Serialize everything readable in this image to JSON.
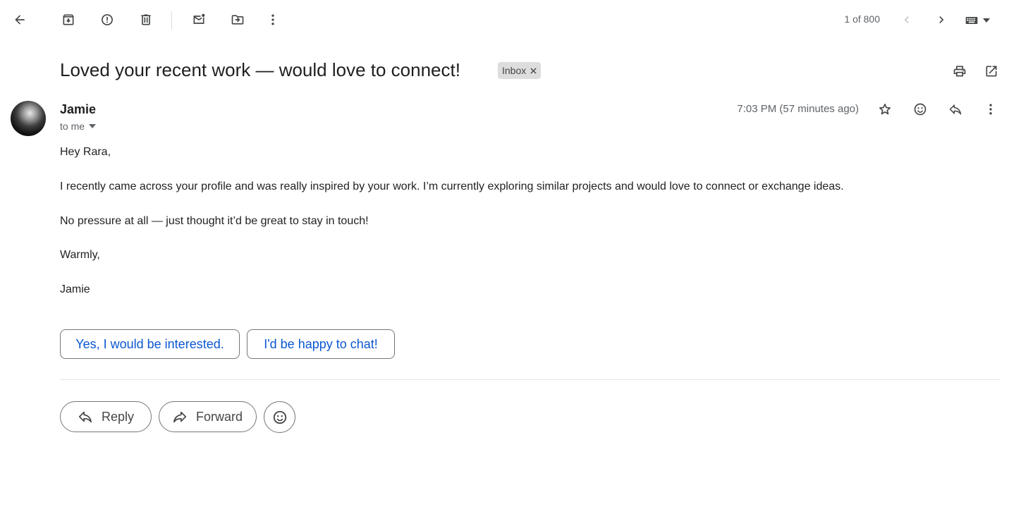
{
  "toolbar": {
    "icons": [
      "back-arrow-icon",
      "archive-icon",
      "report-spam-icon",
      "delete-icon",
      "mark-unread-icon",
      "move-to-icon",
      "more-vert-icon"
    ],
    "pager": "1 of 800"
  },
  "email": {
    "subject": "Loved your recent work — would love to connect!",
    "label": "Inbox",
    "sender": "Jamie",
    "recipient": "to me",
    "time": "7:03 PM (57 minutes ago)",
    "body": [
      "Hey Rara,",
      "I recently came across your profile and was really inspired by your work. I’m currently exploring similar projects and would love to connect or exchange ideas.",
      "No pressure at all — just thought it’d be great to stay in touch!",
      "Warmly,",
      "Jamie"
    ]
  },
  "smart_replies": [
    "Yes, I would be interested.",
    "I'd be happy to chat!"
  ],
  "actions": {
    "reply": "Reply",
    "forward": "Forward"
  },
  "colors": {
    "link_blue": "#0b57d0",
    "icon_gray": "#444746",
    "text_muted": "#5f6368"
  }
}
